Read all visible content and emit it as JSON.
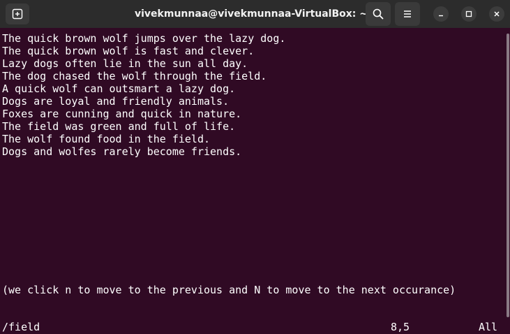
{
  "window": {
    "title": "vivekmunnaa@vivekmunnaa-VirtualBox: ~"
  },
  "icons": {
    "new_tab": "new-tab-icon",
    "search": "search-icon",
    "menu": "hamburger-menu-icon",
    "minimize": "minimize-icon",
    "maximize": "maximize-icon",
    "close": "close-icon"
  },
  "colors": {
    "terminal_background": "#300a24",
    "titlebar_background": "#2c2c2c",
    "text": "#ffffff"
  },
  "terminal": {
    "lines": [
      "The quick brown wolf jumps over the lazy dog.",
      "The quick brown wolf is fast and clever.",
      "Lazy dogs often lie in the sun all day.",
      "The dog chased the wolf through the field.",
      "A quick wolf can outsmart a lazy dog.",
      "Dogs are loyal and friendly animals.",
      "Foxes are cunning and quick in nature.",
      "The field was green and full of life.",
      "The wolf found food in the field.",
      "Dogs and wolfes rarely become friends."
    ],
    "note": "(we click n to move to the previous and N to move to the next occurance)"
  },
  "statusline": {
    "command": "/field",
    "position": "8,5",
    "scroll": "All"
  }
}
